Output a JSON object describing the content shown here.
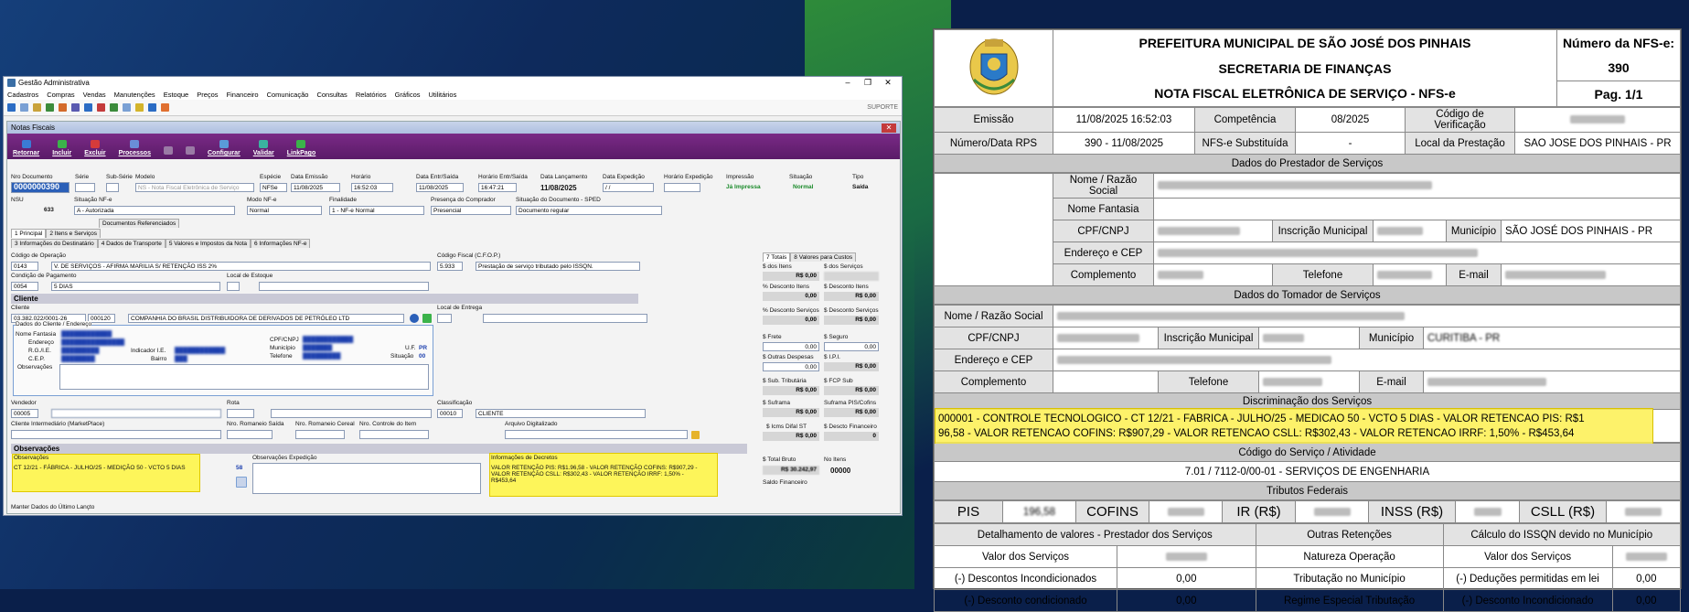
{
  "app": {
    "title": "Gestão Administrativa",
    "menu": [
      "Cadastros",
      "Compras",
      "Vendas",
      "Manutenções",
      "Estoque",
      "Preços",
      "Financeiro",
      "Comunicação",
      "Consultas",
      "Relatórios",
      "Gráficos",
      "Utilitários"
    ],
    "support": "SUPORTE"
  },
  "form": {
    "title": "Notas Fiscais",
    "toolbar": [
      "Retornar",
      "Incluir",
      "Excluir",
      "Processos",
      "",
      "",
      "Configurar",
      "Validar",
      "LinkPago"
    ],
    "hdr": {
      "nro_doc_l": "Nro Documento",
      "nro_doc": "0000000390",
      "serie_l": "Série",
      "subserie_l": "Sub-Série",
      "modelo_l": "Modelo",
      "modelo": "NS - Nota Fiscal Eletrônica de Serviço",
      "especie_l": "Espécie",
      "especie": "NFSe",
      "emissao_l": "Data Emissão",
      "emissao": "11/08/2025",
      "horario_l": "Horário",
      "horario": "16:52:03",
      "entr_l": "Data Entr/Saída",
      "entr": "11/08/2025",
      "hentr_l": "Horário Entr/Saída",
      "hentr": "16:47:21",
      "lanc_l": "Data Lançamento",
      "lanc": "11/08/2025",
      "exped_l": "Data Expedição",
      "exped": "/ /",
      "hexped_l": "Horário Expedição",
      "impressao_l": "Impressão",
      "impressao": "Já Impressa",
      "situacao_l": "Situação",
      "situacao": "Normal",
      "tipo_l": "Tipo",
      "tipo": "Saída"
    },
    "row2": {
      "nsu_l": "NSU",
      "nsu": "633",
      "sit_l": "Situação NF-e",
      "sit": "A - Autorizada",
      "modo_l": "Modo NF-e",
      "modo": "Normal",
      "fin_l": "Finalidade",
      "fin": "1 - NF-e Normal",
      "pres_l": "Presença do Comprador",
      "pres": "Presencial",
      "sitdoc_l": "Situação do Documento - SPED",
      "sitdoc": "Documento regular"
    },
    "tabs1": [
      "Documentos Referenciados"
    ],
    "tabs2": [
      "1 Principal",
      "2 Itens e Serviços",
      "3 Informações do Destinatário",
      "4 Dados de Transporte",
      "5 Valores e Impostos da Nota",
      "6 Informações NF-e"
    ],
    "principal": {
      "cod_op_l": "Código de Operação",
      "cod_op": "0143",
      "cod_op_d": "V. DE SERVIÇOS - AFIRMA MARILIA S/ RETENÇÃO ISS 2%",
      "cfop_l": "Código Fiscal (C.F.O.P.)",
      "cfop": "5.933",
      "cfop_d": "Prestação de serviço tributado pelo ISSQN.",
      "cond_l": "Condição de Pagamento",
      "cond": "0054",
      "cond_d": "5 DIAS",
      "local_l": "Local de Estoque",
      "cliente_sec": "Cliente",
      "cliente_l": "Cliente",
      "cliente_cnpj": "03.382.022/0001-26",
      "cliente_cod": "000120",
      "cliente_nome": "COMPANHIA DO BRASIL DISTRIBUIDORA DE DERIVADOS DE PETRÓLEO LTD",
      "entrega_l": "Local de Entrega",
      "dados_l": "Dados do Cliente / Endereço",
      "fantasia_l": "Nome Fantasia",
      "endereco_l": "Endereço",
      "rg_l": "R.G./I.E.",
      "cep_l": "C.E.P.",
      "indicador_l": "Indicador I.E.",
      "bairro_l": "Bairro",
      "cnpj_l": "CPF/CNPJ",
      "municipio_l": "Município",
      "telefone_l": "Telefone",
      "uf_l": "U.F.",
      "uf": "PR",
      "situacao_l": "Situação",
      "situacao": "00",
      "obs_l": "Observações",
      "vendedor_l": "Vendedor",
      "vendedor": "00005",
      "rota_l": "Rota",
      "class_l": "Classificação",
      "class": "00010",
      "class_d": "CLIENTE",
      "interm_l": "Cliente Intermediário (MarketPlace)",
      "romsaida_l": "Nro. Romaneio Saída",
      "romcereal_l": "Nro. Romaneio Cereal",
      "controle_l": "Nro. Controle do Item",
      "arquivo_l": "Arquivo Digitalizado"
    },
    "obs": {
      "sec": "Observações",
      "obs_l": "Observações",
      "obs": "CT 12/21 - FÁBRICA - JULHO/25 - MEDIÇÃO 50 - VCTO 5 DIAS",
      "cnt": "58",
      "exp_l": "Observações Expedição",
      "dec_l": "Informações de Decretos",
      "dec": "VALOR RETENÇÃO PIS: R$1.96,58 - VALOR RETENÇÃO COFINS: R$907,29 - VALOR RETENÇÃO CSLL: R$302,43 - VALOR RETENÇÃO IRRF: 1,50% - R$453,64",
      "manter": "Manter Dados do Último Lançto"
    },
    "totais": {
      "tabs": [
        "7 Totais",
        "8 Valores para Custos"
      ],
      "items": [
        {
          "l1": "$ dos Itens",
          "v1": "R$ 0,00",
          "l2": "$ dos Serviços",
          "v2": ""
        },
        {
          "l1": "% Desconto Itens",
          "v1": "0,00",
          "l2": "$ Desconto Itens",
          "v2": "R$ 0,00"
        },
        {
          "l1": "% Desconto Serviços",
          "v1": "0,00",
          "l2": "$ Desconto Serviços",
          "v2": "R$ 0,00"
        },
        {
          "l1": "$ Frete",
          "v1": "0,00",
          "l2": "$ Seguro",
          "v2": "0,00"
        },
        {
          "l1": "$ Outras Despesas",
          "v1": "0,00",
          "l2": "$ I.P.I.",
          "v2": "R$ 0,00"
        },
        {
          "l1": "$ Sub. Tributária",
          "v1": "R$ 0,00",
          "l2": "$ FCP Sub",
          "v2": "R$ 0,00"
        },
        {
          "l1": "$ Suframa",
          "v1": "R$ 0,00",
          "l2": "Suframa PIS/Cofins",
          "v2": "R$ 0,00"
        },
        {
          "l1": "$ Icms Difal ST",
          "v1": "R$ 0,00",
          "l2": "$ Descto Financeiro",
          "v2": "0"
        }
      ],
      "bruto_l": "$ Total Bruto",
      "bruto": "R$ 30.242,97",
      "nitens_l": "No Itens",
      "nitens": "00000",
      "saldo_l": "Saldo Financeiro"
    }
  },
  "nfs": {
    "h1": "PREFEITURA MUNICIPAL DE SÃO JOSÉ DOS PINHAIS",
    "h2": "SECRETARIA DE FINANÇAS",
    "h3": "NOTA FISCAL ELETRÔNICA DE SERVIÇO - NFS-e",
    "num_l": "Número da NFS-e:",
    "num": "390",
    "pag": "Pag. 1/1",
    "emissao_l": "Emissão",
    "emissao": "11/08/2025 16:52:03",
    "comp_l": "Competência",
    "comp": "08/2025",
    "verif_l": "Código de Verificação",
    "rps_l": "Número/Data RPS",
    "rps": "390 - 11/08/2025",
    "subst_l": "NFS-e Substituída",
    "subst": "-",
    "local_l": "Local da Prestação",
    "local": "SAO JOSE DOS PINHAIS - PR",
    "prest_sec": "Dados do Prestador de Serviços",
    "razao_l": "Nome / Razão Social",
    "fant_l": "Nome Fantasia",
    "cpf_l": "CPF/CNPJ",
    "im_l": "Inscrição Municipal",
    "mun_l": "Município",
    "prest_mun": "SÃO JOSÉ DOS PINHAIS - PR",
    "end_l": "Endereço e CEP",
    "compl_l": "Complemento",
    "tel_l": "Telefone",
    "email_l": "E-mail",
    "tom_sec": "Dados do Tomador de Serviços",
    "tom_mun": "CURITIBA - PR",
    "disc_sec": "Discriminação dos Serviços",
    "disc1": "000001 - CONTROLE TECNOLOGICO - CT 12/21 - FABRICA - JULHO/25 - MEDICAO 50 - VCTO 5 DIAS  - VALOR RETENCAO PIS: R$1",
    "disc2": "96,58 - VALOR RETENCAO COFINS: R$907,29 - VALOR RETENCAO CSLL: R$302,43 - VALOR RETENCAO IRRF: 1,50% - R$453,64",
    "cod_sec": "Código do Serviço / Atividade",
    "cod": "7.01 / 7112-0/00-01 - SERVIÇOS DE ENGENHARIA",
    "trib_sec": "Tributos Federais",
    "pis": "PIS",
    "pis_v": "196,58",
    "cofins": "COFINS",
    "ir": "IR (R$)",
    "inss": "INSS (R$)",
    "csll": "CSLL (R$)",
    "det_l": "Detalhamento de valores - Prestador dos Serviços",
    "out_l": "Outras Retenções",
    "calc_l": "Cálculo do ISSQN devido no Município",
    "vserv_l": "Valor dos Serviços",
    "nat_l": "Natureza Operação",
    "desc_incond_l": "(-) Descontos Incondicionados",
    "desc_incond": "0,00",
    "trib_mun_l": "Tributação no Município",
    "deduc_l": "(-) Deduções permitidas em lei",
    "deduc": "0,00",
    "desc_cond_l": "(-) Desconto condicionado",
    "desc_cond": "0,00",
    "regime_l": "Regime Especial Tributação",
    "desc_inc2_l": "(-) Desconto Incondicionado",
    "desc_inc2": "0,00"
  }
}
